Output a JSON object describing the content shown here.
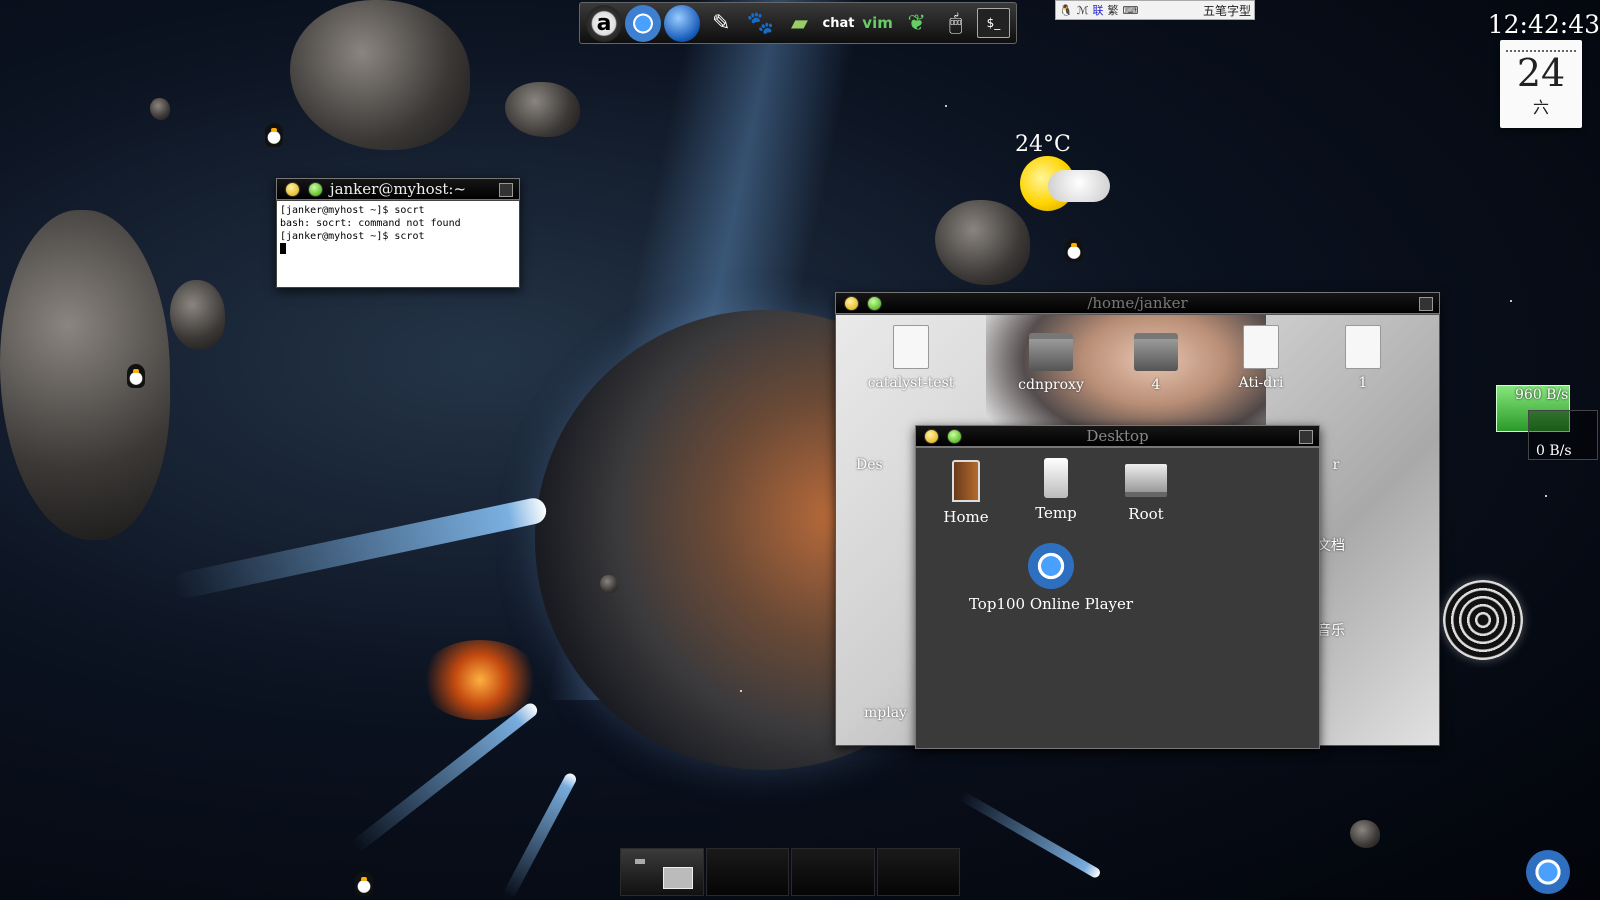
{
  "dock": {
    "icons": [
      "a-icon",
      "chrome-icon",
      "globe-icon",
      "gimp-icon",
      "paw-icon",
      "book-icon",
      "chat-icon",
      "vim-icon",
      "leaf-icon",
      "mouse-icon",
      "terminal-icon"
    ],
    "chat_label": "chat",
    "vim_label": "vim",
    "term_label": "$_"
  },
  "ime": {
    "label": "五笔字型",
    "items": [
      "联",
      "繁"
    ]
  },
  "clock": {
    "time": "12:42:43"
  },
  "calendar": {
    "day": "24",
    "weekday": "六"
  },
  "weather": {
    "temperature": "24°C"
  },
  "terminal": {
    "title": "janker@myhost:~",
    "lines": [
      "[janker@myhost ~]$ socrt",
      "bash: socrt: command not found",
      "[janker@myhost ~]$ scrot"
    ]
  },
  "file_manager": {
    "title": "/home/janker",
    "items": [
      {
        "label": "catalyst-test",
        "type": "doc"
      },
      {
        "label": "cdnproxy",
        "type": "folder"
      },
      {
        "label": "4",
        "type": "folder"
      },
      {
        "label": "Ati-dri",
        "type": "doc"
      },
      {
        "label": "1",
        "type": "doc"
      }
    ],
    "partial": [
      "Des",
      "mplay",
      "文档",
      "音乐",
      "r"
    ]
  },
  "desktop_window": {
    "title": "Desktop",
    "items": [
      {
        "label": "Home",
        "icon": "home-icon"
      },
      {
        "label": "Temp",
        "icon": "temp-icon"
      },
      {
        "label": "Root",
        "icon": "root-icon"
      },
      {
        "label": "Top100 Online Player",
        "icon": "player-icon"
      }
    ]
  },
  "network": {
    "down": "960 B/s",
    "up": "0 B/s"
  },
  "taskbar": {
    "slots": 4
  }
}
